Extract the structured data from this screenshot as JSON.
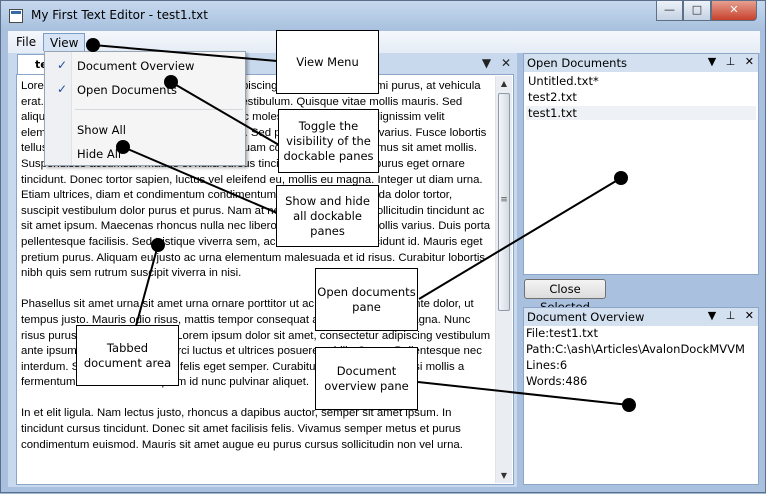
{
  "window": {
    "title": "My First Text Editor - test1.txt"
  },
  "window_buttons": {
    "minimize": "—",
    "maximize": "□",
    "close": "✕"
  },
  "menubar": {
    "file": "File",
    "view": "View"
  },
  "view_menu": {
    "items": [
      {
        "label": "Document Overview",
        "checked": true
      },
      {
        "label": "Open Documents",
        "checked": true
      },
      {
        "label": "Show All"
      },
      {
        "label": "Hide All"
      }
    ],
    "check_glyph": "✓"
  },
  "doc_tab": {
    "label": "te"
  },
  "doc_tools": {
    "dropdown": "▼",
    "close": "✕"
  },
  "document": {
    "text": "Lorem ipsum dolor sit amet, consectetur adipiscing elit. Integer rutrum mi purus, at vehicula erat. Nunc tincidunt mi eu nibh fermentum vestibulum. Quisque vitae mollis mauris. Sed aliquet tincidunt erat, a sollicitudin leo. Donec molestie lorem at purus dignissim velit elementum. Nunc pellentesque. Nulla facilisi. Sed pellentesque cursus varius. Fusce lobortis tellus ut sodales. Vivamus vitae est orci, aliquam commodo tellus. Vivamus sit amet mollis. Suspendisse accumsan mauris et nulla cursus tincidunt. Curabitur vel purus eget ornare tincidunt. Donec tortor sapien, luctus vel eleifend eu, mollis eu magna. Integer ut diam urna. Etiam ultrices, diam et condimentum condimentum, arcu diam malesuada dolor tortor, suscipit vestibulum dolor purus et purus. Nam at neque nulla. Nullam sollicitudin tincidunt ac sit amet ipsum. Maecenas rhoncus nulla nec libero volutpat, sit amet mollis varius. Duis porta pellentesque facilisis. Sed tristique viverra sem, ac sollicitudin diam tincidunt id. Mauris eget pretium purus. Aliquam eu justo ac urna elementum malesuada et id risus. Curabitur lobortis nibh quis sem rutrum suscipit viverra in nisi.\n\nPhasellus sit amet urna sit amet urna ornare porttitor ut ac velit. Integer eget ante dolor, ut tempus justo. Mauris odio risus, mattis tempor consequat at, consectetur ut magna. Nunc risus purus, nec pretium justo. Lorem ipsum dolor sit amet, consectetur adipiscing vestibulum ante ipsum primis in faucibus orci luctus et ultrices posuere cubilia Curae. Pellentesque nec interdum. Sed fringilla faucibus felis eget semper. Curabitur blandit libero ac nisi mollis a fermentum risus. Donec at quam id nunc pulvinar aliquet.\n\nIn et elit ligula. Nam lectus justo, rhoncus a dapibus auctor, semper sit amet ipsum. In tincidunt cursus tincidunt. Donec sit amet facilisis felis. Vivamus semper metus et purus condimentum euismod. Mauris sit amet augue eu purus cursus sollicitudin non vel urna."
  },
  "scrollbar": {
    "up": "▲",
    "down": "▼",
    "grip": "≡"
  },
  "open_documents": {
    "title": "Open Documents",
    "items": [
      {
        "label": "Untitled.txt*"
      },
      {
        "label": "test2.txt"
      },
      {
        "label": "test1.txt",
        "selected": true
      }
    ],
    "close_selected": "Close Selected"
  },
  "document_overview": {
    "title": "Document Overview",
    "lines": [
      "File:test1.txt",
      "Path:C:\\ash\\Articles\\AvalonDockMVVM",
      "Lines:6",
      "Words:486"
    ]
  },
  "pane_tools": {
    "dropdown": "▼",
    "pin": "⊥",
    "close": "✕"
  },
  "callouts": {
    "view_menu": "View Menu",
    "toggle": "Toggle the visibility of the dockable panes",
    "show_hide": "Show and hide all dockable panes",
    "open_documents_pane": "Open documents pane",
    "tabbed_area": "Tabbed document area",
    "overview_pane": "Document overview pane"
  }
}
